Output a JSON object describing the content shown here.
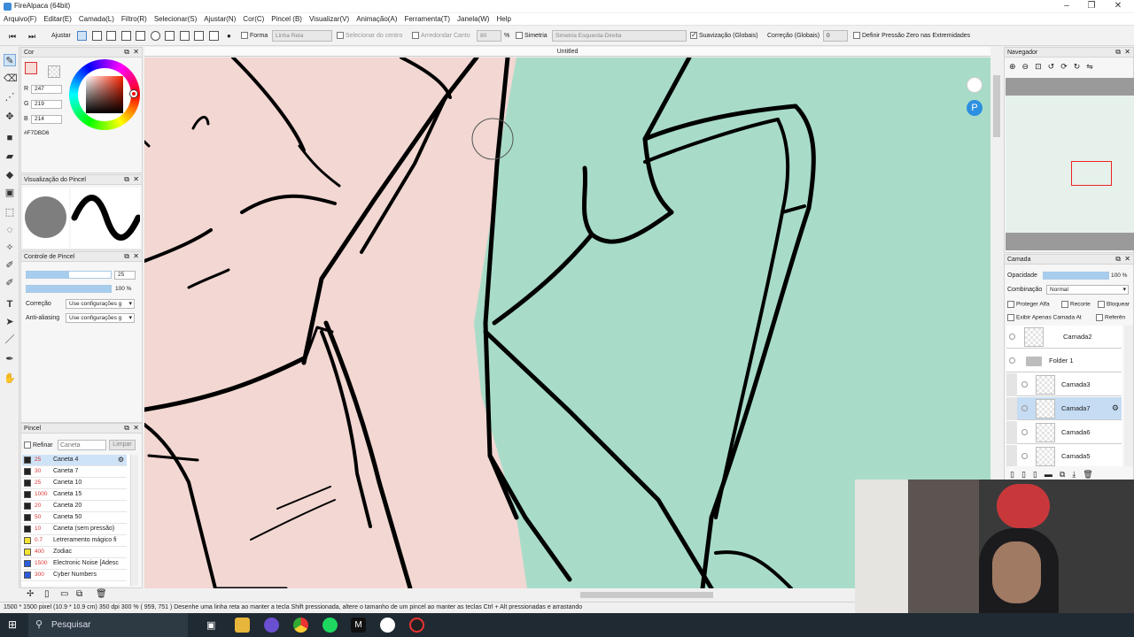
{
  "window": {
    "title": "FireAlpaca (64bit)"
  },
  "menu": [
    "Arquivo(F)",
    "Editar(E)",
    "Camada(L)",
    "Filtro(R)",
    "Selecionar(S)",
    "Ajustar(N)",
    "Cor(C)",
    "Pincel (B)",
    "Visualizar(V)",
    "Animação(A)",
    "Ferramenta(T)",
    "Janela(W)",
    "Help"
  ],
  "toolbar": {
    "adjust_label": "Ajustar",
    "shape_label": "Forma",
    "shape_value": "Linha Reta",
    "select_center_label": "Selecionar do centro",
    "round_corner_label": "Arredondar Canto",
    "round_corner_value": "80",
    "percent": "%",
    "symmetry_label": "Simetria",
    "symmetry_value": "Simetria Esquerda-Direita",
    "smoothing_label": "Suavização (Globais)",
    "correction_label": "Correção (Globais)",
    "correction_value": "0",
    "pressure_label": "Definir Pressão Zero nas Extremidades"
  },
  "color_panel": {
    "title": "Cor",
    "r_label": "R",
    "r": "247",
    "g_label": "G",
    "g": "219",
    "b_label": "B",
    "b": "214",
    "hex": "#F7DBD6",
    "current_color": "#f7dbd6"
  },
  "brush_preview": {
    "title": "Visualização do Pincel"
  },
  "brush_control": {
    "title": "Controle de Pincel",
    "size": "25",
    "opacity": "100 %",
    "correction_label": "Correção",
    "correction_value": "Use configurações g",
    "antialias_label": "Anti-aliasing",
    "antialias_value": "Use configurações g"
  },
  "brush_panel": {
    "title": "Pincel",
    "refine_label": "Refinar",
    "search_placeholder": "Caneta",
    "clear_label": "Limpar",
    "brushes": [
      {
        "size": "25",
        "name": "Caneta 4",
        "color": "#222222"
      },
      {
        "size": "30",
        "name": "Caneta 7",
        "color": "#222222"
      },
      {
        "size": "25",
        "name": "Caneta 10",
        "color": "#222222"
      },
      {
        "size": "1000",
        "name": "Caneta 15",
        "color": "#222222"
      },
      {
        "size": "20",
        "name": "Caneta 20",
        "color": "#222222"
      },
      {
        "size": "50",
        "name": "Caneta 50",
        "color": "#222222"
      },
      {
        "size": "10",
        "name": "Caneta (sem pressão)",
        "color": "#222222"
      },
      {
        "size": "0.7",
        "name": "Letreramento mágico fi",
        "color": "#f4e232"
      },
      {
        "size": "400",
        "name": "Zodiac",
        "color": "#f4e232"
      },
      {
        "size": "1500",
        "name": "Electronic Noise [Adesc",
        "color": "#2a5bd8"
      },
      {
        "size": "300",
        "name": "Cyber Numbers",
        "color": "#2a5bd8"
      }
    ]
  },
  "canvas": {
    "tab_title": "Untitled"
  },
  "navigator": {
    "title": "Navegador"
  },
  "layer_panel": {
    "title": "Camada",
    "opacity_label": "Opacidade",
    "opacity_value": "100 %",
    "blend_label": "Combinação",
    "blend_value": "Normal",
    "protect_alpha": "Proteger Alfa",
    "clipping": "Recorte",
    "lock": "Bloquear",
    "show_current_only": "Exibir Apenas Camada At",
    "reference": "Referên",
    "layers": [
      {
        "name": "Camada2",
        "kind": "layer"
      },
      {
        "name": "Folder 1",
        "kind": "folder"
      },
      {
        "name": "Camada3",
        "kind": "layer"
      },
      {
        "name": "Camada7",
        "kind": "layer"
      },
      {
        "name": "Camada6",
        "kind": "layer"
      },
      {
        "name": "Camada5",
        "kind": "layer"
      }
    ]
  },
  "status": {
    "text": "1500 * 1500 pixel  (10.9 * 10.9 cm)  350 dpi  300 %  ( 959, 751 )  Desenhe uma linha reta ao manter a tecla Shift pressionada, altere o tamanho de um pincel ao manter as teclas Ctrl + Alt pressionadas e arrastando"
  },
  "taskbar": {
    "search_label": "Pesquisar"
  }
}
